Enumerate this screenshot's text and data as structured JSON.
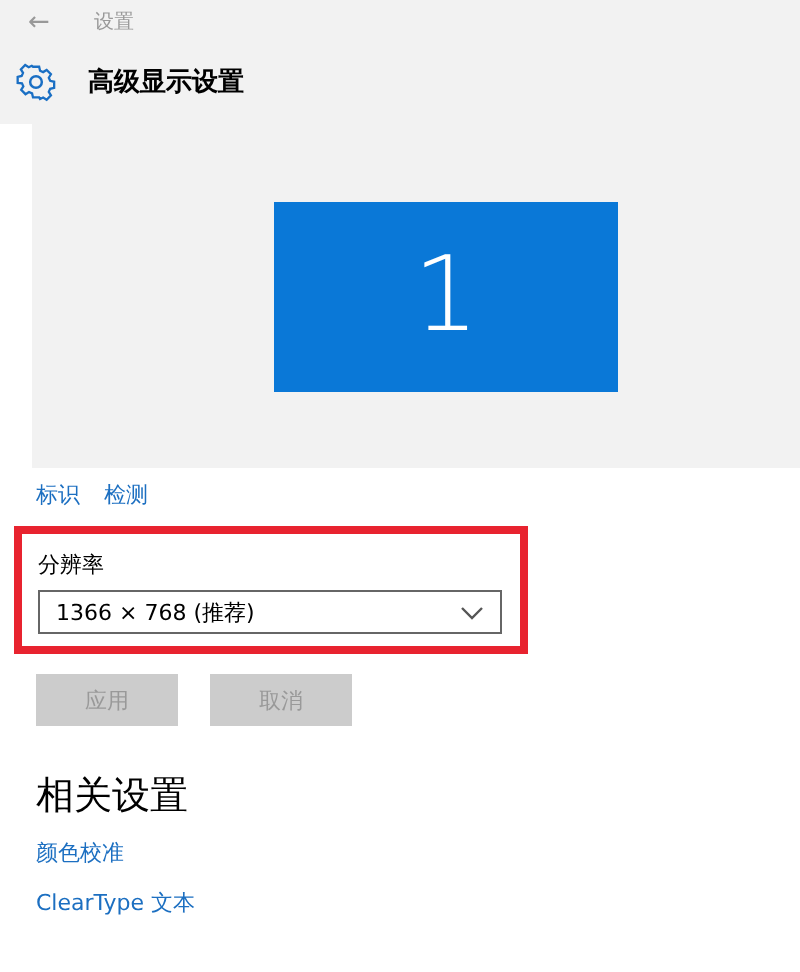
{
  "window": {
    "back": "←",
    "title": "设置"
  },
  "header": {
    "title": "高级显示设置"
  },
  "display_preview": {
    "monitors": [
      {
        "label": "1",
        "selected": true
      }
    ]
  },
  "display_links": [
    "标识",
    "检测"
  ],
  "resolution": {
    "label": "分辨率",
    "value": "1366 × 768 (推荐)",
    "highlighted": true
  },
  "buttons": [
    {
      "label": "应用",
      "disabled": true
    },
    {
      "label": "取消",
      "disabled": true
    }
  ],
  "related_settings": {
    "heading": "相关设置",
    "links": [
      "颜色校准",
      "ClearType 文本"
    ]
  }
}
